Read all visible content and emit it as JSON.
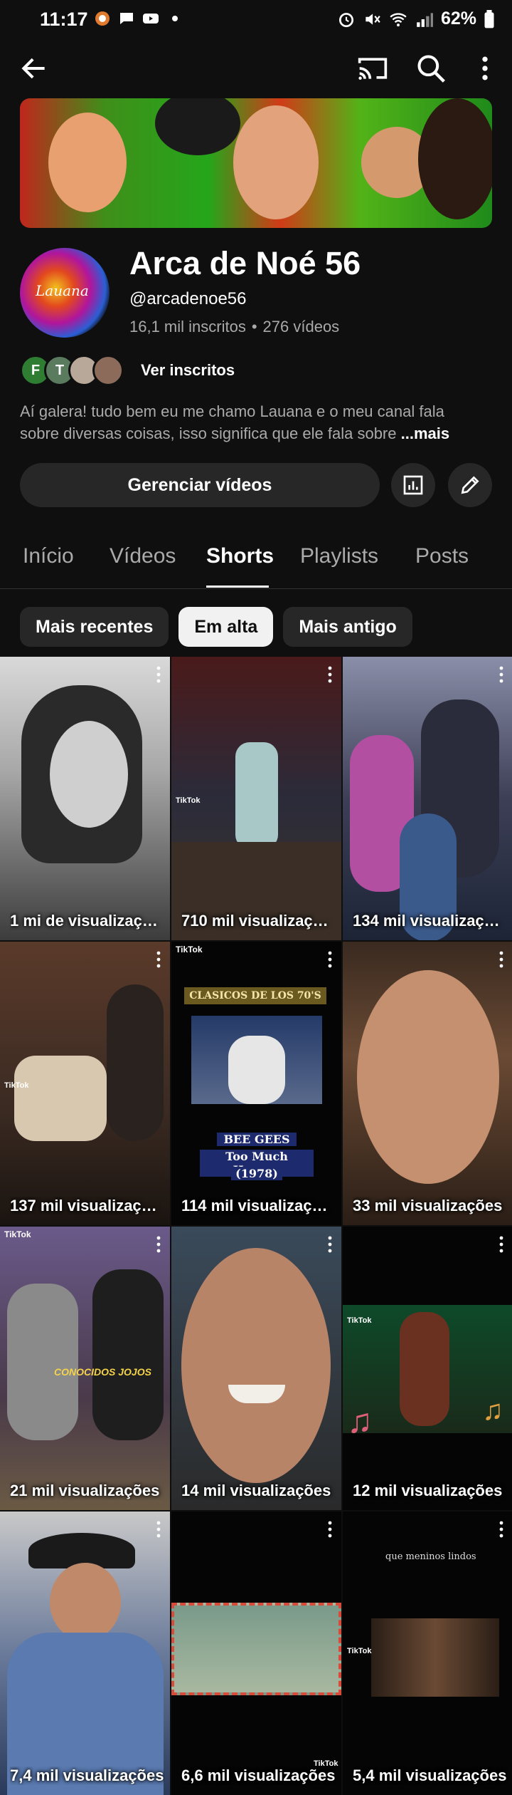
{
  "status": {
    "time": "11:17",
    "battery": "62%"
  },
  "channel": {
    "name": "Arca de Noé 56",
    "handle": "@arcadenoe56",
    "subscribers": "16,1 mil inscritos",
    "separator": "•",
    "video_count": "276 vídeos",
    "avatar_text": "Lauana",
    "subscriber_avatars": [
      "F",
      "T"
    ],
    "see_subscribers": "Ver inscritos",
    "description_line1": "Aí galera! tudo bem eu me chamo Lauana e o meu canal fala",
    "description_line2": "sobre diversas coisas, isso significa que ele fala sobre",
    "more_label": "...mais",
    "manage_videos": "Gerenciar vídeos"
  },
  "tabs": [
    "Início",
    "Vídeos",
    "Shorts",
    "Playlists",
    "Posts"
  ],
  "active_tab": "Shorts",
  "chips": [
    "Mais recentes",
    "Em alta",
    "Mais antigo"
  ],
  "active_chip": "Em alta",
  "shorts": [
    {
      "views": "1 mi de visualizações"
    },
    {
      "views": "710 mil visualizações"
    },
    {
      "views": "134 mil visualizações"
    },
    {
      "views": "137 mil visualizações"
    },
    {
      "views": "114 mil visualizações",
      "overlay_top": "CLASICOS DE LOS 70'S",
      "overlay_bottom_1": "BEE GEES",
      "overlay_bottom_2": "Too Much Heaven",
      "overlay_bottom_3": "(1978)"
    },
    {
      "views": "33 mil visualizações"
    },
    {
      "views": "21 mil visualizações",
      "overlay_caption": "CONOCIDOS JOJOS"
    },
    {
      "views": "14 mil visualizações"
    },
    {
      "views": "12 mil visualizações"
    },
    {
      "views": "7,4 mil visualizações"
    },
    {
      "views": "6,6 mil visualizações"
    },
    {
      "views": "5,4 mil visualizações",
      "overlay_caption": "que meninos lindos"
    }
  ],
  "tiktok_label": "TikTok",
  "colors": {
    "background": "#0f0f0f",
    "chip_bg": "#272727",
    "chip_active_bg": "#f1f1f1",
    "secondary_text": "#aaaaaa"
  }
}
